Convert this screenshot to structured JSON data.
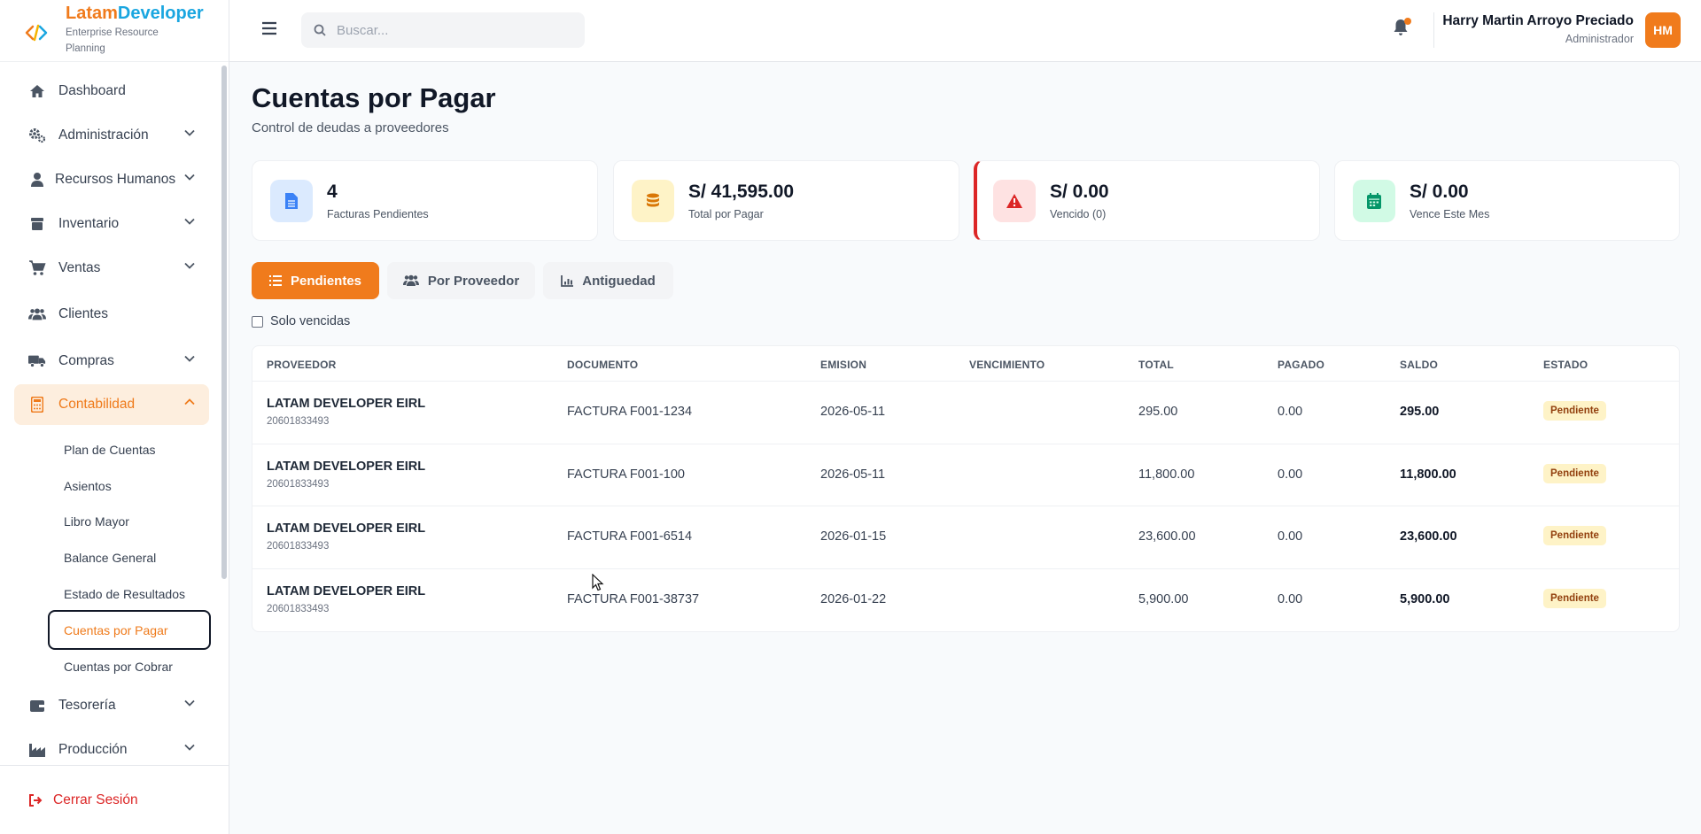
{
  "brand": {
    "name_part1": "Latam",
    "name_part2": "Developer",
    "subtitle": "Enterprise Resource Planning"
  },
  "sidebar": {
    "items": [
      {
        "label": "Dashboard",
        "icon": "home-icon"
      },
      {
        "label": "Administración",
        "icon": "gears-icon"
      },
      {
        "label": "Recursos Humanos",
        "icon": "user-tie-icon"
      },
      {
        "label": "Inventario",
        "icon": "box-icon"
      },
      {
        "label": "Ventas",
        "icon": "cart-icon"
      },
      {
        "label": "Clientes",
        "icon": "users-icon"
      },
      {
        "label": "Compras",
        "icon": "truck-icon"
      },
      {
        "label": "Contabilidad",
        "icon": "calculator-icon"
      },
      {
        "label": "Tesorería",
        "icon": "wallet-icon"
      },
      {
        "label": "Producción",
        "icon": "industry-icon"
      }
    ],
    "sub_items": [
      "Plan de Cuentas",
      "Asientos",
      "Libro Mayor",
      "Balance General",
      "Estado de Resultados",
      "Cuentas por Pagar",
      "Cuentas por Cobrar"
    ],
    "logout": "Cerrar Sesión"
  },
  "topbar": {
    "search_placeholder": "Buscar...",
    "user_name": "Harry Martin Arroyo Preciado",
    "user_role": "Administrador",
    "avatar_initials": "HM"
  },
  "page": {
    "title": "Cuentas por Pagar",
    "subtitle": "Control de deudas a proveedores"
  },
  "cards": [
    {
      "value": "4",
      "label": "Facturas Pendientes",
      "icon": "file-icon",
      "color": "#3b82f6",
      "bg": "#dbeafe"
    },
    {
      "value": "S/ 41,595.00",
      "label": "Total por Pagar",
      "icon": "coins-icon",
      "color": "#d97706",
      "bg": "#fef3c7"
    },
    {
      "value": "S/ 0.00",
      "label": "Vencido (0)",
      "icon": "warning-icon",
      "color": "#dc2626",
      "bg": "#fee2e2"
    },
    {
      "value": "S/ 0.00",
      "label": "Vence Este Mes",
      "icon": "calendar-icon",
      "color": "#059669",
      "bg": "#d1fae5"
    }
  ],
  "tabs": [
    {
      "label": "Pendientes"
    },
    {
      "label": "Por Proveedor"
    },
    {
      "label": "Antiguedad"
    }
  ],
  "filter": {
    "label": "Solo vencidas"
  },
  "table": {
    "headers": [
      "PROVEEDOR",
      "DOCUMENTO",
      "EMISION",
      "VENCIMIENTO",
      "TOTAL",
      "PAGADO",
      "SALDO",
      "ESTADO"
    ],
    "rows": [
      {
        "proveedor": "LATAM DEVELOPER EIRL",
        "ruc": "20601833493",
        "documento": "FACTURA F001-1234",
        "emision": "2026-05-11",
        "vencimiento": "",
        "total": "295.00",
        "pagado": "0.00",
        "saldo": "295.00",
        "estado": "Pendiente"
      },
      {
        "proveedor": "LATAM DEVELOPER EIRL",
        "ruc": "20601833493",
        "documento": "FACTURA F001-100",
        "emision": "2026-05-11",
        "vencimiento": "",
        "total": "11,800.00",
        "pagado": "0.00",
        "saldo": "11,800.00",
        "estado": "Pendiente"
      },
      {
        "proveedor": "LATAM DEVELOPER EIRL",
        "ruc": "20601833493",
        "documento": "FACTURA F001-6514",
        "emision": "2026-01-15",
        "vencimiento": "",
        "total": "23,600.00",
        "pagado": "0.00",
        "saldo": "23,600.00",
        "estado": "Pendiente"
      },
      {
        "proveedor": "LATAM DEVELOPER EIRL",
        "ruc": "20601833493",
        "documento": "FACTURA F001-38737",
        "emision": "2026-01-22",
        "vencimiento": "",
        "total": "5,900.00",
        "pagado": "0.00",
        "saldo": "5,900.00",
        "estado": "Pendiente"
      }
    ]
  },
  "colors": {
    "accent": "#f07b1c",
    "brand_blue": "#1aa6e0",
    "danger": "#dc2626"
  }
}
